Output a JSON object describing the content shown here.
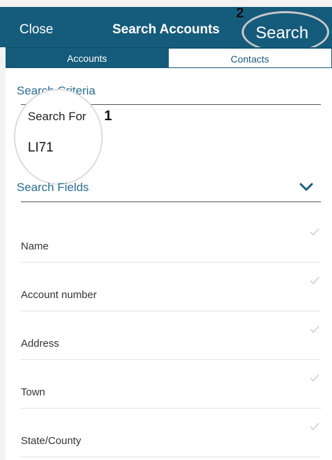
{
  "header": {
    "close_label": "Close",
    "title": "Search Accounts",
    "search_label": "Search",
    "callout_2": "2"
  },
  "tabs": [
    {
      "label": "Accounts",
      "selected": true
    },
    {
      "label": "Contacts",
      "selected": false
    }
  ],
  "criteria": {
    "section_title": "Search Criteria",
    "search_for_label": "Search For",
    "search_value": "LI71",
    "callout_1": "1"
  },
  "fields": {
    "section_title": "Search Fields",
    "items": [
      {
        "label": "Name"
      },
      {
        "label": "Account number"
      },
      {
        "label": "Address"
      },
      {
        "label": "Town"
      },
      {
        "label": "State/County"
      }
    ]
  },
  "colors": {
    "header_bg": "#155b7b",
    "accent_text": "#2b6d92",
    "check": "#cfcfcf"
  },
  "icons": {
    "expand": "chevron-down-icon",
    "field_selected": "checkmark-icon"
  }
}
